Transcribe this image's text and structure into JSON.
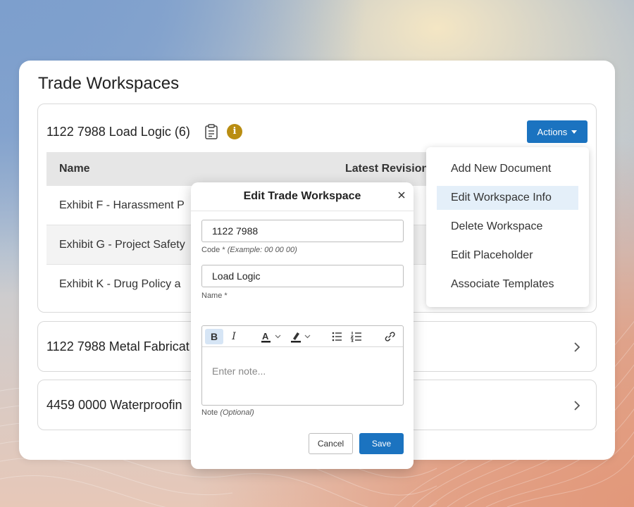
{
  "page": {
    "title": "Trade Workspaces"
  },
  "workspaces": [
    {
      "title": "1122 7988 Load Logic (6)",
      "actions_label": "Actions",
      "table": {
        "headers": [
          "Name",
          "Latest Revision"
        ],
        "rows": [
          "Exhibit F - Harassment P",
          "Exhibit G - Project Safety",
          "Exhibit K - Drug Policy a"
        ]
      }
    },
    {
      "title": "1122 7988 Metal Fabricat"
    },
    {
      "title": "4459 0000 Waterproofin"
    }
  ],
  "actions_menu": {
    "items": [
      {
        "label": "Add New Document"
      },
      {
        "label": "Edit Workspace Info",
        "active": true
      },
      {
        "label": "Delete Workspace"
      },
      {
        "label": "Edit Placeholder"
      },
      {
        "label": "Associate Templates"
      }
    ]
  },
  "modal": {
    "title": "Edit Trade Workspace",
    "code_value": "1122 7988",
    "code_label": "Code *",
    "code_example": "(Example: 00 00 00)",
    "name_value": "Load Logic",
    "name_label": "Name *",
    "note_placeholder": "Enter note...",
    "note_label": "Note",
    "note_optional": "(Optional)",
    "bold_label": "B",
    "italic_label": "I",
    "cancel_label": "Cancel",
    "save_label": "Save"
  },
  "colors": {
    "primary": "#1b73c0",
    "info": "#b98d12",
    "menu_active": "#e4eff9"
  },
  "icons": [
    "clipboard-icon",
    "info-icon",
    "caret-down-icon",
    "chevron-right-icon",
    "close-icon",
    "text-color-icon",
    "highlight-icon",
    "bullet-list-icon",
    "numbered-list-icon",
    "link-icon"
  ]
}
